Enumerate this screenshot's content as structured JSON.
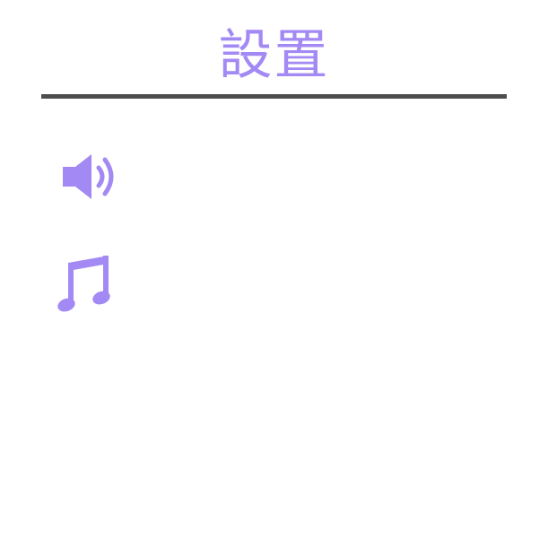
{
  "header": {
    "title": "設置"
  },
  "settings": [
    {
      "id": "sound",
      "icon": "speaker-volume-icon"
    },
    {
      "id": "music",
      "icon": "music-note-icon"
    }
  ],
  "colors": {
    "accent": "#a389f4",
    "divider": "#4d4d4d",
    "background": "#ffffff"
  }
}
